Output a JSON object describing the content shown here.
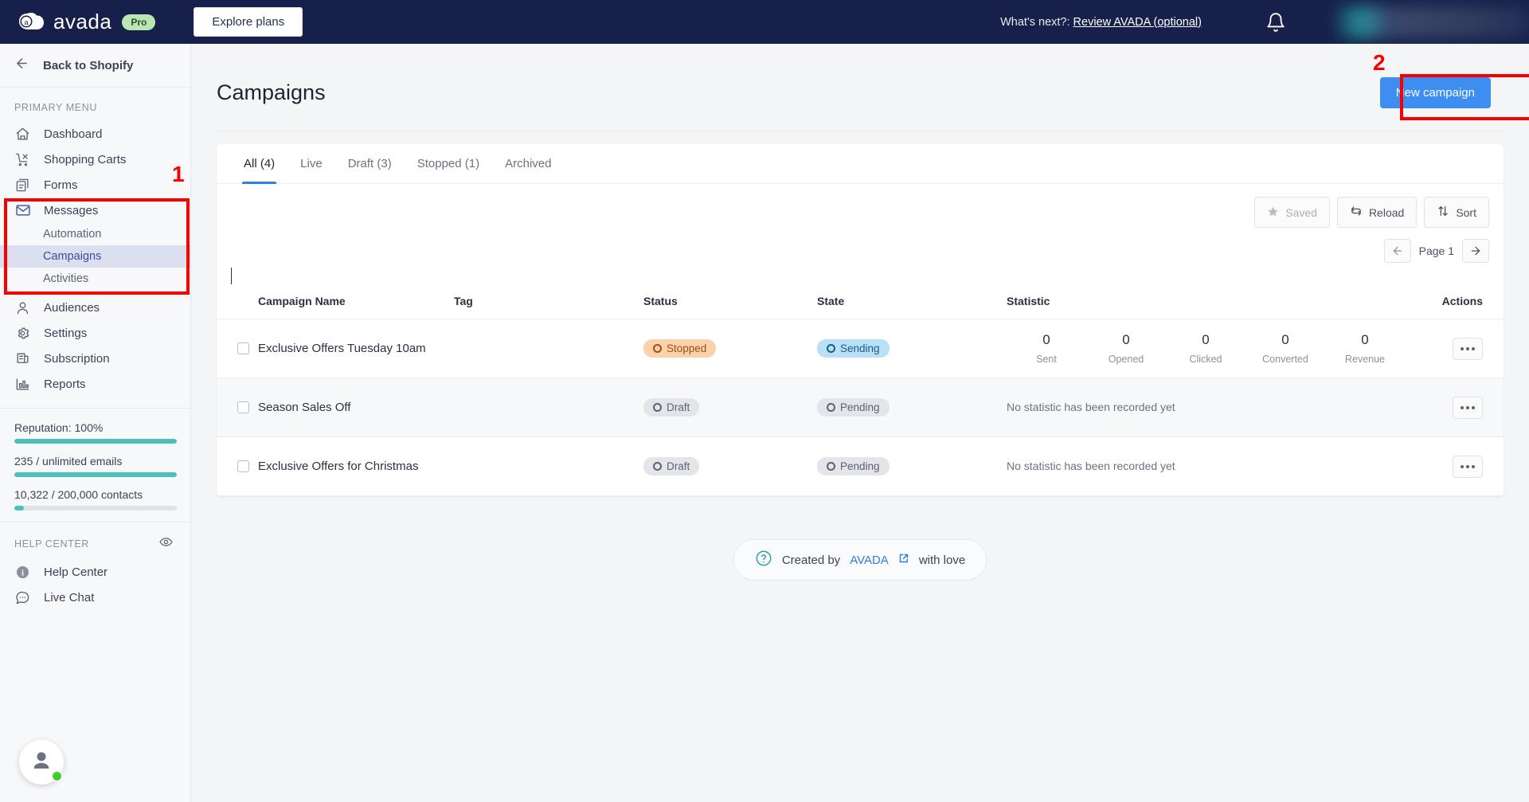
{
  "topbar": {
    "brand_name": "avada",
    "pro_badge": "Pro",
    "explore_plans": "Explore plans",
    "whats_next_prefix": "What's next?:",
    "whats_next_link": "Review AVADA (optional)",
    "bell_icon": "bell-icon",
    "bg_color": "#16204a"
  },
  "sidebar": {
    "back_label": "Back to Shopify",
    "primary_menu_label": "PRIMARY MENU",
    "items": [
      {
        "label": "Dashboard",
        "icon": "home-icon"
      },
      {
        "label": "Shopping Carts",
        "icon": "cart-icon"
      },
      {
        "label": "Forms",
        "icon": "form-icon"
      },
      {
        "label": "Messages",
        "icon": "envelope-icon"
      }
    ],
    "messages_subitems": [
      {
        "label": "Automation",
        "active": false
      },
      {
        "label": "Campaigns",
        "active": true
      },
      {
        "label": "Activities",
        "active": false
      }
    ],
    "items_lower": [
      {
        "label": "Audiences",
        "icon": "person-icon"
      },
      {
        "label": "Settings",
        "icon": "gear-icon"
      },
      {
        "label": "Subscription",
        "icon": "subscription-icon"
      },
      {
        "label": "Reports",
        "icon": "bar-chart-icon"
      }
    ],
    "meters": [
      {
        "label": "Reputation: 100%",
        "percent": 100
      },
      {
        "label": "235 / unlimited emails",
        "percent": 100
      },
      {
        "label": "10,322 / 200,000 contacts",
        "percent": 6
      }
    ],
    "help_center_label": "HELP CENTER",
    "eye_icon": "eye-icon",
    "help_items": [
      {
        "label": "Help Center",
        "icon": "info-icon"
      },
      {
        "label": "Live Chat",
        "icon": "chat-bubble-icon"
      }
    ],
    "accent_color": "#4fbfbc"
  },
  "main": {
    "page_title": "Campaigns",
    "new_campaign_label": "New campaign",
    "new_campaign_color": "#3d8ef0",
    "tabs": [
      {
        "label": "All (4)",
        "active": true
      },
      {
        "label": "Live",
        "active": false
      },
      {
        "label": "Draft (3)",
        "active": false
      },
      {
        "label": "Stopped (1)",
        "active": false
      },
      {
        "label": "Archived",
        "active": false
      }
    ],
    "toolbar": {
      "saved_label": "Saved",
      "saved_icon": "star-icon",
      "reload_label": "Reload",
      "reload_icon": "refresh-icon",
      "sort_label": "Sort",
      "sort_icon": "sort-arrows-icon"
    },
    "pager": {
      "prev_icon": "arrow-left-icon",
      "page_label": "Page 1",
      "next_icon": "arrow-right-icon"
    },
    "table": {
      "headers": [
        "Campaign Name",
        "Tag",
        "Status",
        "State",
        "Statistic",
        "Actions"
      ],
      "stat_labels": [
        "Sent",
        "Opened",
        "Clicked",
        "Converted",
        "Revenue"
      ],
      "rows": [
        {
          "name": "Exclusive Offers Tuesday 10am",
          "tag": "",
          "status": "Stopped",
          "status_kind": "stopped",
          "state": "Sending",
          "state_kind": "sending",
          "has_stats": true,
          "stats": [
            "0",
            "0",
            "0",
            "0",
            "0"
          ],
          "no_stat_text": ""
        },
        {
          "name": "Season Sales Off",
          "tag": "",
          "status": "Draft",
          "status_kind": "draft",
          "state": "Pending",
          "state_kind": "pending",
          "has_stats": false,
          "stats": [],
          "no_stat_text": "No statistic has been recorded yet"
        },
        {
          "name": "Exclusive Offers for Christmas",
          "tag": "",
          "status": "Draft",
          "status_kind": "draft",
          "state": "Pending",
          "state_kind": "pending",
          "has_stats": false,
          "stats": [],
          "no_stat_text": "No statistic has been recorded yet"
        }
      ],
      "actions_icon": "ellipsis-icon"
    },
    "footer": {
      "help_icon": "question-circle-icon",
      "prefix": "Created by",
      "brand": "AVADA",
      "external_icon": "external-link-icon",
      "suffix": "with love"
    }
  },
  "chat_widget": {
    "avatar_icon": "user-avatar-icon",
    "online": true,
    "online_color": "#3ecf2e"
  },
  "annotations": [
    {
      "number": "1",
      "target": "sidebar-messages-group",
      "color": "#f70000"
    },
    {
      "number": "2",
      "target": "new-campaign-button",
      "color": "#f70000"
    }
  ]
}
